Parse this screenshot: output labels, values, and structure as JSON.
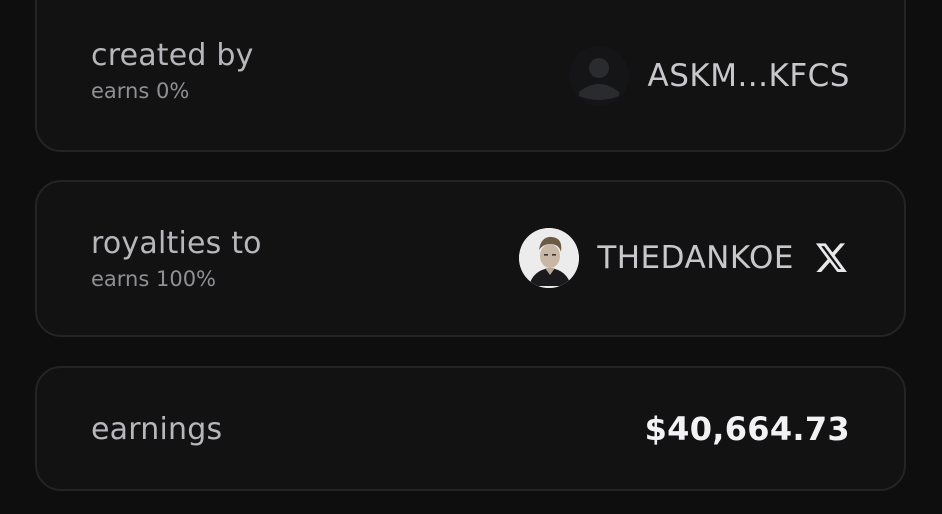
{
  "created_by": {
    "label": "created by",
    "earns": "earns 0%",
    "user": {
      "address": "ASKM...KFCS",
      "avatar_icon": "default-user-avatar-icon"
    }
  },
  "royalties_to": {
    "label": "royalties to",
    "earns": "earns 100%",
    "user": {
      "name": "THEDANKOE",
      "avatar_icon": "profile-photo",
      "social_icon": "x-logo-icon"
    }
  },
  "earnings": {
    "label": "earnings",
    "value": "$40,664.73"
  },
  "colors": {
    "background": "#0e0e0f",
    "card": "#121213",
    "card_border": "#242426",
    "label_text": "#b7b7bb",
    "sublabel_text": "#8f8f94",
    "value_text": "#c8c8cc",
    "value_strong": "#f2f2f4"
  }
}
